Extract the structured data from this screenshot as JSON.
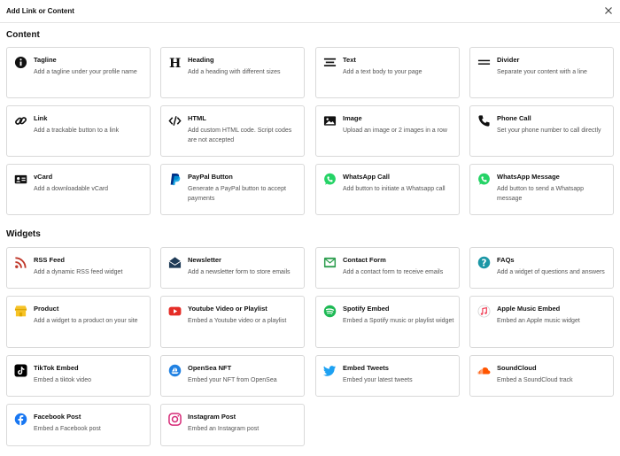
{
  "modal": {
    "title": "Add Link or Content"
  },
  "sections": {
    "content": "Content",
    "widgets": "Widgets"
  },
  "content_items": [
    {
      "label": "Tagline",
      "desc": "Add a tagline under your profile name",
      "icon": "info-icon"
    },
    {
      "label": "Heading",
      "desc": "Add a heading with different sizes",
      "icon": "heading-icon"
    },
    {
      "label": "Text",
      "desc": "Add a text body to your page",
      "icon": "text-align-icon"
    },
    {
      "label": "Divider",
      "desc": "Separate your content with a line",
      "icon": "divider-icon"
    },
    {
      "label": "Link",
      "desc": "Add a trackable button to a link",
      "icon": "link-icon"
    },
    {
      "label": "HTML",
      "desc": "Add custom HTML code. Script codes are not accepted",
      "icon": "code-icon"
    },
    {
      "label": "Image",
      "desc": "Upload an image or 2 images in a row",
      "icon": "image-icon"
    },
    {
      "label": "Phone Call",
      "desc": "Set your phone number to call directly",
      "icon": "phone-icon"
    },
    {
      "label": "vCard",
      "desc": "Add a downloadable vCard",
      "icon": "vcard-icon"
    },
    {
      "label": "PayPal Button",
      "desc": "Generate a PayPal button to accept payments",
      "icon": "paypal-icon"
    },
    {
      "label": "WhatsApp Call",
      "desc": "Add button to initiate a Whatsapp call",
      "icon": "whatsapp-icon"
    },
    {
      "label": "WhatsApp Message",
      "desc": "Add button to send a Whatsapp message",
      "icon": "whatsapp-icon"
    }
  ],
  "widget_items": [
    {
      "label": "RSS Feed",
      "desc": "Add a dynamic RSS feed widget",
      "icon": "rss-icon"
    },
    {
      "label": "Newsletter",
      "desc": "Add a newsletter form to store emails",
      "icon": "envelope-open-icon"
    },
    {
      "label": "Contact Form",
      "desc": "Add a contact form to receive emails",
      "icon": "contact-form-icon"
    },
    {
      "label": "FAQs",
      "desc": "Add a widget of questions and answers",
      "icon": "question-circle-icon"
    },
    {
      "label": "Product",
      "desc": "Add a widget to a product on your site",
      "icon": "store-icon"
    },
    {
      "label": "Youtube Video or Playlist",
      "desc": "Embed a Youtube video or a playlist",
      "icon": "youtube-icon"
    },
    {
      "label": "Spotify Embed",
      "desc": "Embed a Spotify music or playlist widget",
      "icon": "spotify-icon"
    },
    {
      "label": "Apple Music Embed",
      "desc": "Embed an Apple music widget",
      "icon": "apple-music-icon"
    },
    {
      "label": "TikTok Embed",
      "desc": "Embed a tiktok video",
      "icon": "tiktok-icon"
    },
    {
      "label": "OpenSea NFT",
      "desc": "Embed your NFT from OpenSea",
      "icon": "opensea-icon"
    },
    {
      "label": "Embed Tweets",
      "desc": "Embed your latest tweets",
      "icon": "twitter-icon"
    },
    {
      "label": "SoundCloud",
      "desc": "Embed a SoundCloud track",
      "icon": "soundcloud-icon"
    },
    {
      "label": "Facebook Post",
      "desc": "Embed a Facebook post",
      "icon": "facebook-icon"
    },
    {
      "label": "Instagram Post",
      "desc": "Embed an Instagram post",
      "icon": "instagram-icon"
    }
  ],
  "colors": {
    "rss": "#c0392b",
    "newsletter": "#1f3b57",
    "contact_form": "#2e9e4f",
    "faqs": "#1c97a6",
    "product": "#f7c325",
    "youtube": "#e52d27",
    "spotify": "#1db954",
    "apple_music": "#f0435a",
    "tiktok": "#000000",
    "opensea": "#2081e2",
    "twitter": "#1da1f2",
    "soundcloud": "#ff5500",
    "facebook": "#1877f2",
    "instagram": "#d62976",
    "whatsapp": "#25d366",
    "paypal": "#003087"
  }
}
